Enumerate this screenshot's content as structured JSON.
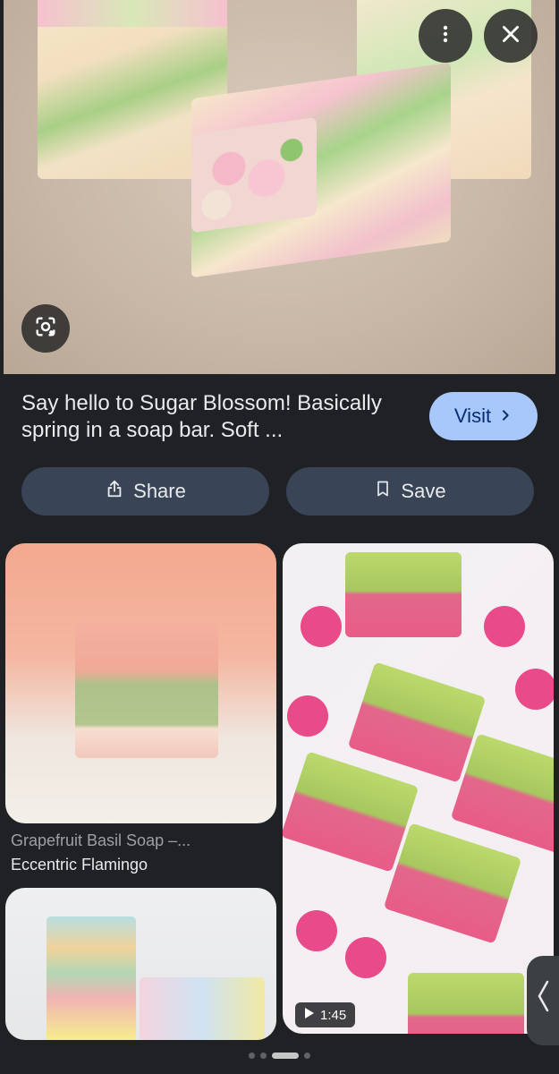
{
  "result": {
    "title": "Say hello to Sugar Blossom! Basically spring in a soap bar. Soft ...",
    "visit_label": "Visit"
  },
  "actions": {
    "share_label": "Share",
    "save_label": "Save"
  },
  "grid": {
    "items": [
      {
        "title": "Grapefruit Basil Soap –...",
        "source": "Eccentric Flamingo"
      },
      {
        "duration": "1:45"
      }
    ]
  },
  "icons": {
    "more": "more-vert-icon",
    "close": "close-icon",
    "lens": "google-lens-icon",
    "share": "share-icon",
    "save": "bookmark-icon",
    "visit": "chevron-right-icon",
    "play": "play-icon",
    "handle": "chevron-left-icon"
  },
  "pagination": {
    "count": 4,
    "active_index": 2
  },
  "colors": {
    "visit_bg": "#a8c7fa",
    "pill_bg": "#394457",
    "background": "#202124"
  }
}
